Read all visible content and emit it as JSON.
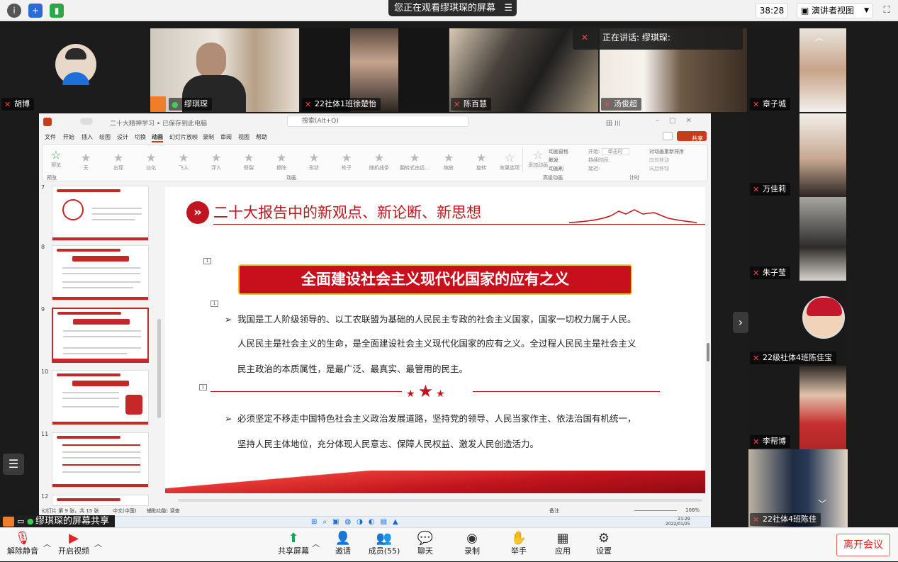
{
  "topbar": {
    "viewing_text": "您正在观看缪琪琛的屏幕",
    "timer": "38:28",
    "presenter_view": "演讲者视图"
  },
  "speaking": {
    "text": "正在讲话: 缪琪琛:"
  },
  "participants_top": [
    "胡博",
    "缪琪琛",
    "22社体1班徐楚怡",
    "陈百慧",
    "汤俊超"
  ],
  "participants_right": [
    "章子城",
    "万佳莉",
    "朱子莹",
    "22级社体4班陈佳宝",
    "李帮博",
    "22社体4班陈佳"
  ],
  "ppt": {
    "title": "二十大精神学习 • 已保存到此电脑",
    "search": "搜索(Alt+Q)",
    "user": "田 川",
    "share": "共享",
    "menu": [
      "文件",
      "开始",
      "插入",
      "绘图",
      "设计",
      "切换",
      "动画",
      "幻灯片放映",
      "录制",
      "审阅",
      "视图",
      "帮助"
    ],
    "preview": "预览",
    "animations": [
      "无",
      "出现",
      "淡化",
      "飞入",
      "浮入",
      "劈裂",
      "擦除",
      "形状",
      "轮子",
      "随机线条",
      "翻转式由远...",
      "缩放",
      "旋转"
    ],
    "effect_options": "效果选项",
    "add_animation": "添加动画",
    "anim_pane": "动画窗格",
    "trigger": "触发",
    "anim_painter": "动画刷",
    "start_label": "开始:",
    "start_value": "单击时",
    "duration_label": "持续时间:",
    "delay_label": "延迟:",
    "reorder": "对动画重新排序",
    "move_earlier": "向前移动",
    "move_later": "向后移动",
    "group_preview": "预览",
    "group_anim": "动画",
    "group_adv": "高级动画",
    "group_timing": "计时",
    "thumb_numbers": [
      "7",
      "8",
      "9",
      "10",
      "11",
      "12"
    ],
    "statusbar_left": "幻灯片 第 9 张，共 15 张",
    "statusbar_lang": "中文(中国)",
    "statusbar_access": "辅助功能: 调查",
    "statusbar_notes": "备注",
    "zoom": "108%",
    "clock_time": "21:29",
    "clock_date": "2022/01/25"
  },
  "slide": {
    "title": "二十大报告中的新观点、新论断、新思想",
    "banner": "全面建设社会主义现代化国家的应有之义",
    "para1_line1": "我国是工人阶级领导的、以工农联盟为基础的人民民主专政的社会主义国家，国家一切权力属于人民。",
    "para1_line2": "人民民主是社会主义的生命，是全面建设社会主义现代化国家的应有之义。全过程人民民主是社会主义",
    "para1_line3": "民主政治的本质属性，是最广泛、最真实、最管用的民主。",
    "para2_line1": "必须坚定不移走中国特色社会主义政治发展道路，坚持党的领导、人民当家作主、依法治国有机统一，",
    "para2_line2": "坚持人民主体地位，充分体现人民意志、保障人民权益、激发人民创造活力。",
    "marker": "1"
  },
  "share_banner": "缪琪琛的屏幕共享",
  "bottombar": {
    "unmute": "解除静音",
    "video": "开启视频",
    "share": "共享屏幕",
    "invite": "邀请",
    "members": "成员(55)",
    "chat": "聊天",
    "record": "录制",
    "raise": "举手",
    "apps": "应用",
    "settings": "设置",
    "leave": "离开会议"
  },
  "colors": {
    "accent_red": "#c8101c",
    "gold": "#f3c325",
    "leave_red": "#e02424"
  }
}
